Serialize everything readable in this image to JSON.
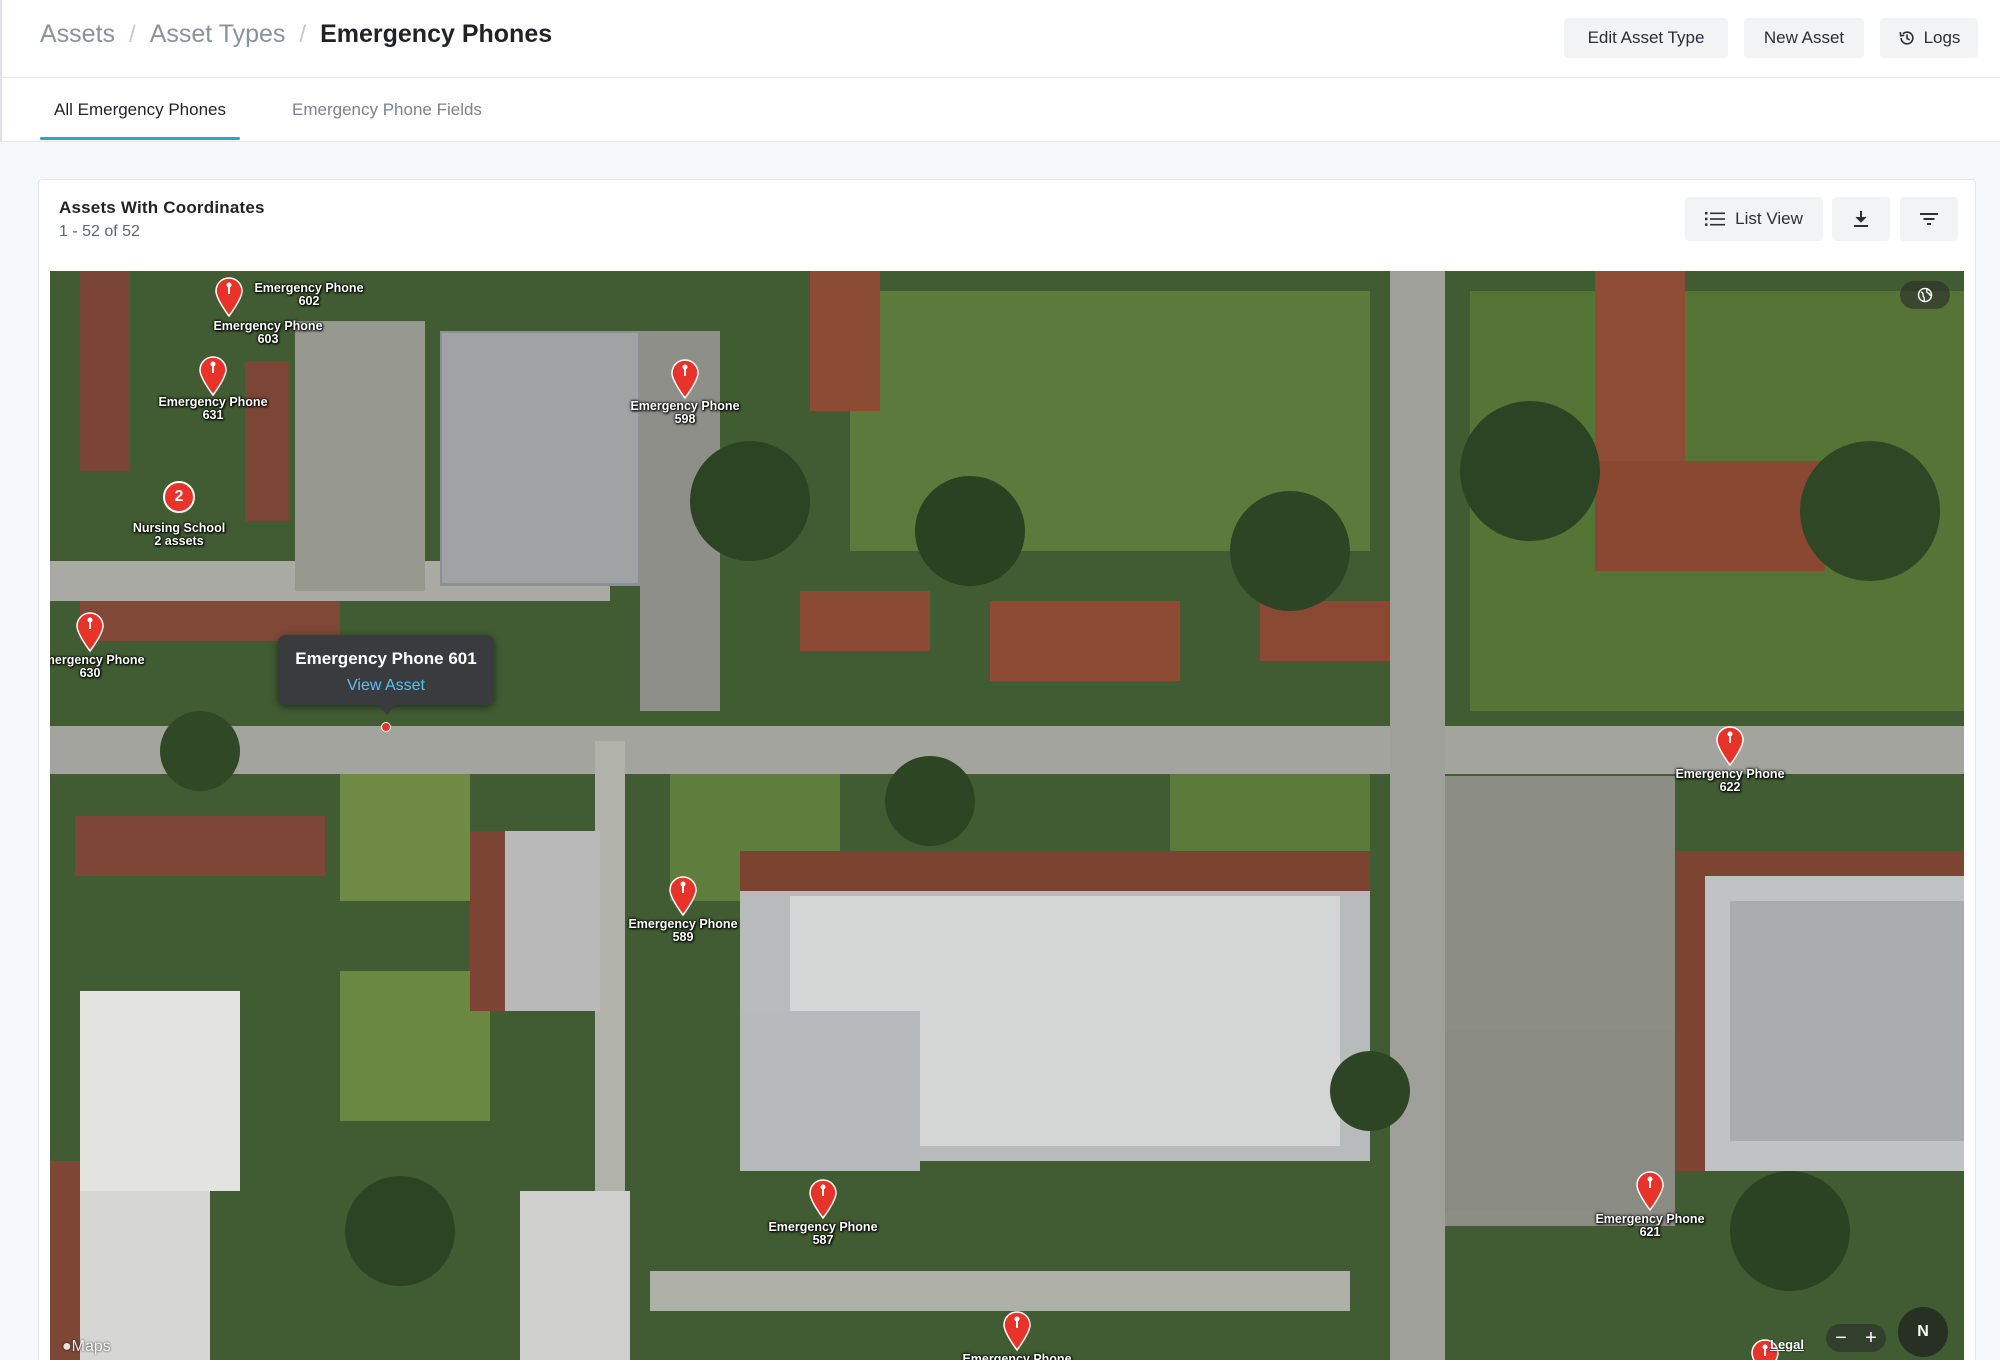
{
  "breadcrumb": {
    "items": [
      "Assets",
      "Asset Types"
    ],
    "separator": "/",
    "current": "Emergency Phones"
  },
  "header_actions": {
    "edit_label": "Edit Asset Type",
    "new_label": "New Asset",
    "logs_label": "Logs"
  },
  "tabs": [
    {
      "label": "All Emergency Phones",
      "active": true
    },
    {
      "label": "Emergency Phone Fields",
      "active": false
    }
  ],
  "card": {
    "title": "Assets With Coordinates",
    "count": "1 - 52 of 52",
    "list_view_label": "List View"
  },
  "map": {
    "markers": [
      {
        "line1": "Emergency Phone",
        "line2": "602"
      },
      {
        "line1": "Emergency Phone",
        "line2": "603"
      },
      {
        "line1": "Emergency Phone",
        "line2": "631"
      },
      {
        "line1": "Emergency Phone",
        "line2": "598"
      },
      {
        "line1": "Emergency Phone",
        "line2": "630"
      },
      {
        "line1": "Emergency Phone",
        "line2": "622"
      },
      {
        "line1": "Emergency Phone",
        "line2": "589"
      },
      {
        "line1": "Emergency Phone",
        "line2": "587"
      },
      {
        "line1": "Emergency Phone",
        "line2": "621"
      },
      {
        "line1": "Emergency Phone",
        "line2": ""
      }
    ],
    "cluster": {
      "count": "2",
      "line1": "Nursing School",
      "line2": "2 assets"
    },
    "popup": {
      "title": "Emergency Phone 601",
      "link": "View Asset"
    },
    "compass": "N",
    "zoom_out": "−",
    "zoom_in": "+",
    "legal": "Legal",
    "attribution": "Maps"
  },
  "colors": {
    "accent": "#2ba3c7",
    "pin": "#e8332b",
    "popup_bg": "#3a3b3e",
    "popup_link": "#5bc0f5"
  }
}
